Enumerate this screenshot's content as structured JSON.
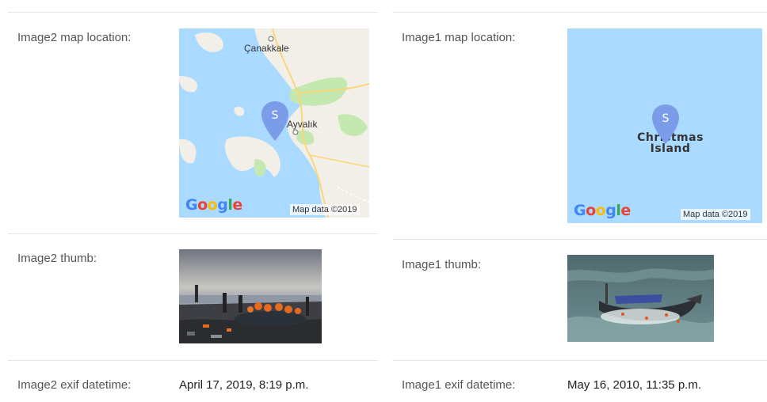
{
  "left": {
    "map_label": "Image2 map location:",
    "map": {
      "city1": "Çanakkale",
      "city2": "Ayvalık",
      "pin_letter": "S",
      "google": "Google",
      "attribution": "Map data ©2019",
      "colors": {
        "water": "#aadaff",
        "land": "#f2efe9",
        "park": "#c3e8b0",
        "road": "#fbd679",
        "pin": "#7b9ce8"
      }
    },
    "thumb_label": "Image2 thumb:",
    "thumb_alt": "Migrants on a rocky beach with a rubber dinghy and life jackets",
    "exif_label": "Image2 exif datetime:",
    "exif_value": "April 17, 2019, 8:19 p.m."
  },
  "right": {
    "map_label": "Image1 map location:",
    "map": {
      "island_line1": "Christmas",
      "island_line2": "Island",
      "pin_letter": "S",
      "google": "Google",
      "attribution": "Map data ©2019",
      "colors": {
        "water": "#aadaff",
        "pin": "#7b9ce8"
      }
    },
    "thumb_label": "Image1 thumb:",
    "thumb_alt": "Wrecked boat in rough sea",
    "exif_label": "Image1 exif datetime:",
    "exif_value": "May 16, 2010, 11:35 p.m."
  }
}
